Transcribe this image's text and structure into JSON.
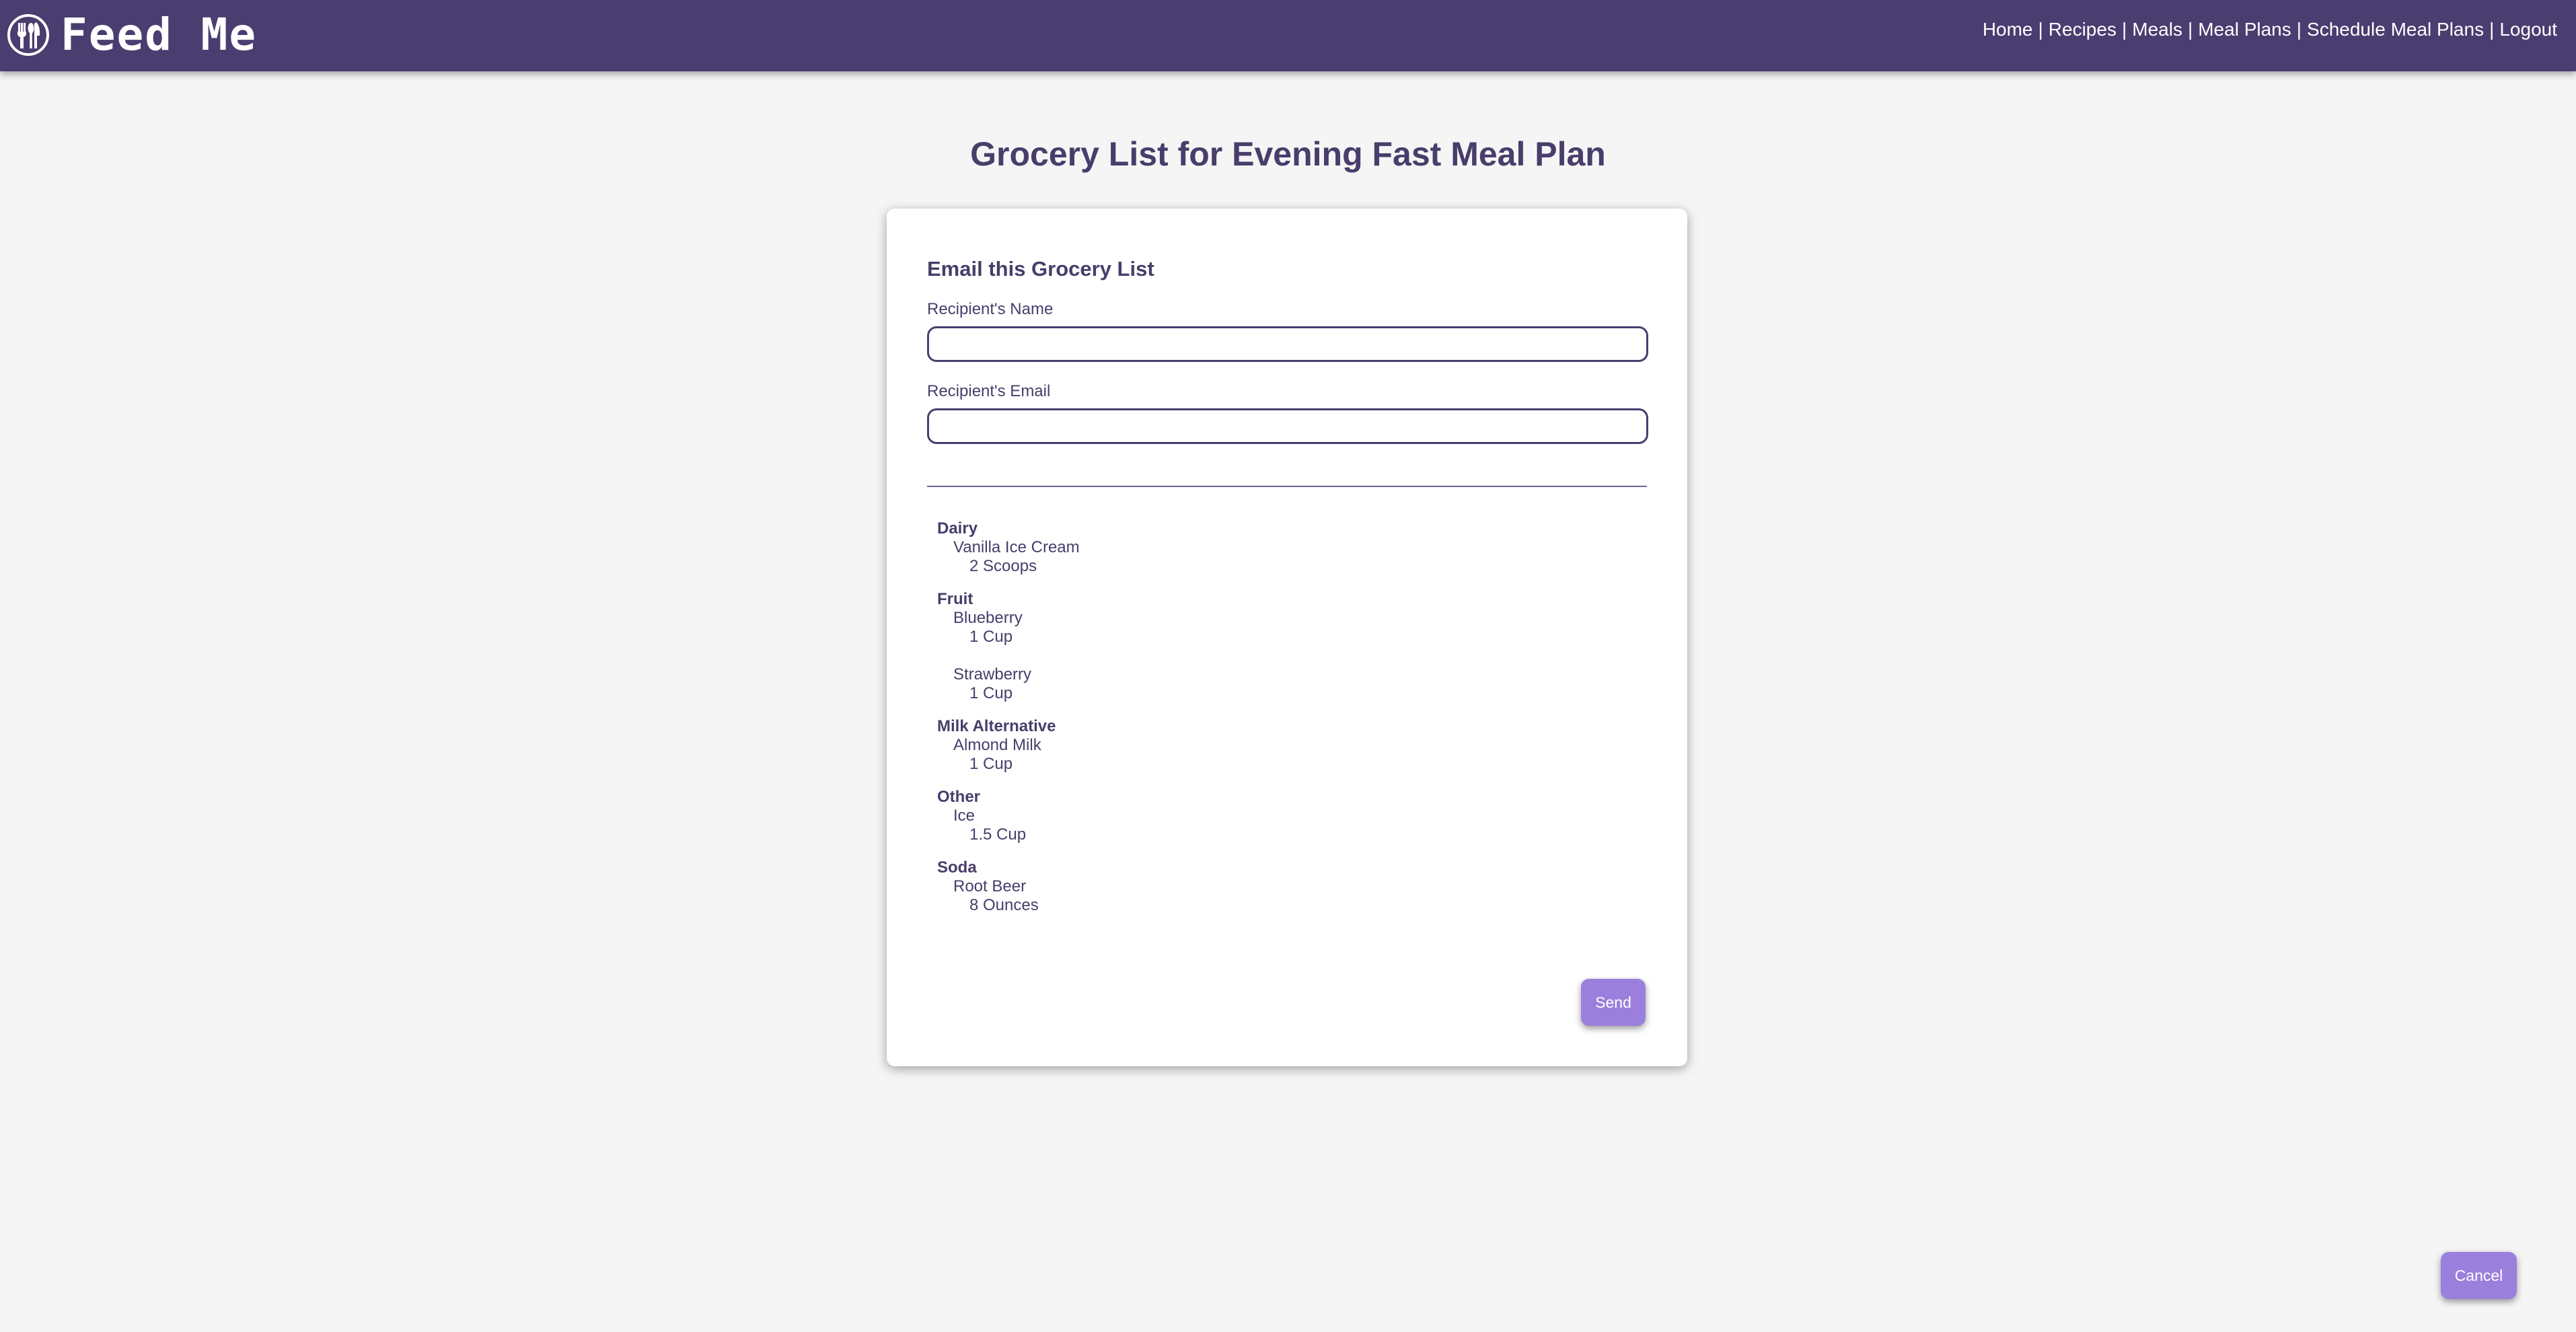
{
  "header": {
    "brand": "Feed Me",
    "logo_icon": "fork-spoon-knife-icon",
    "nav": [
      "Home",
      "Recipes",
      "Meals",
      "Meal Plans",
      "Schedule Meal Plans",
      "Logout"
    ],
    "nav_separator": "|",
    "background": "#4a3d70"
  },
  "page": {
    "title": "Grocery List for Evening Fast Meal Plan"
  },
  "email_form": {
    "heading": "Email this Grocery List",
    "name_label": "Recipient's Name",
    "name_value": "",
    "email_label": "Recipient's Email",
    "email_value": "",
    "send_label": "Send"
  },
  "grocery_list": [
    {
      "category": "Dairy",
      "items": [
        {
          "name": "Vanilla Ice Cream",
          "qty": "2 Scoops"
        }
      ]
    },
    {
      "category": "Fruit",
      "items": [
        {
          "name": "Blueberry",
          "qty": "1 Cup"
        },
        {
          "name": "Strawberry",
          "qty": "1 Cup"
        }
      ]
    },
    {
      "category": "Milk Alternative",
      "items": [
        {
          "name": "Almond Milk",
          "qty": "1 Cup"
        }
      ]
    },
    {
      "category": "Other",
      "items": [
        {
          "name": "Ice",
          "qty": "1.5 Cup"
        }
      ]
    },
    {
      "category": "Soda",
      "items": [
        {
          "name": "Root Beer",
          "qty": "8 Ounces"
        }
      ]
    }
  ],
  "footer": {
    "cancel_label": "Cancel"
  },
  "colors": {
    "accent": "#9b7fdc",
    "text": "#483d6b",
    "page_bg": "#f5f5f5"
  }
}
